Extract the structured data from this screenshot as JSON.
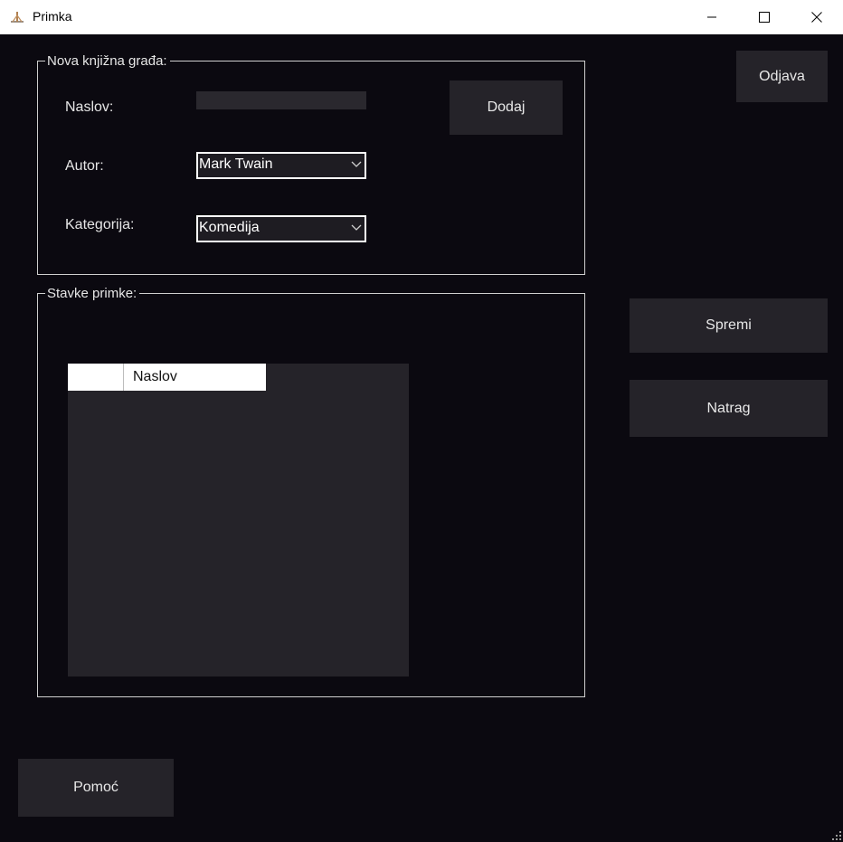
{
  "window": {
    "title": "Primka",
    "icon": "app-icon",
    "controls": [
      "minimize-icon",
      "maximize-icon",
      "close-icon"
    ]
  },
  "new_material": {
    "legend": "Nova knjižna građa:",
    "title_label": "Naslov:",
    "title_value": "",
    "author_label": "Autor:",
    "author_value": "Mark Twain",
    "category_label": "Kategorija:",
    "category_value": "Komedija",
    "add_button": "Dodaj"
  },
  "items": {
    "legend": "Stavke primke:",
    "columns": [
      "Naslov"
    ],
    "rows": []
  },
  "buttons": {
    "logout": "Odjava",
    "save": "Spremi",
    "back": "Natrag",
    "help": "Pomoć"
  },
  "colors": {
    "background": "#0b0910",
    "button": "#252329",
    "text": "#e6e6e6"
  }
}
